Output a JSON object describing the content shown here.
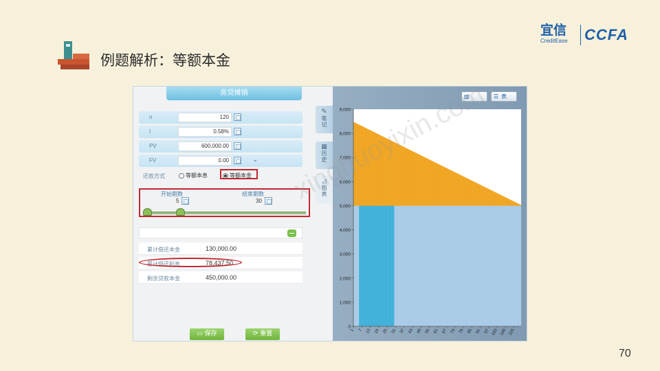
{
  "slide": {
    "title": "例题解析：等额本金",
    "page_number": "70",
    "logo_primary": "宜信",
    "logo_primary_sub": "CreditEase",
    "logo_secondary": "CCFA"
  },
  "panel": {
    "header": "房贷摊销",
    "inputs": [
      {
        "label": "n",
        "value": "120"
      },
      {
        "label": "I",
        "value": "0.58%"
      },
      {
        "label": "PV",
        "value": "600,000.00"
      },
      {
        "label": "FV",
        "value": "0.00"
      }
    ],
    "repay": {
      "label": "还款方式",
      "option_a": "等额本息",
      "option_b": "等额本金",
      "selected": "等额本金"
    },
    "period": {
      "start_label": "开始期数",
      "start_value": "5",
      "end_label": "结束期数",
      "end_value": "30"
    },
    "results": [
      {
        "label": "累计偿还本金",
        "value": "130,000.00"
      },
      {
        "label": "累计偿还利息",
        "value": "78,437.50"
      },
      {
        "label": "剩余贷款本金",
        "value": "450,000.00"
      }
    ],
    "save_label": "保存",
    "reset_label": "重置"
  },
  "side_tabs": [
    {
      "label": "笔记"
    },
    {
      "label": "历史"
    },
    {
      "label": "图表"
    }
  ],
  "chart_toolbar": {
    "chart_label": "",
    "table_label": "表"
  },
  "chart_data": {
    "type": "area",
    "x_start": 1,
    "x_end": 120,
    "x_tick_labels": [
      "1",
      "7",
      "13",
      "19",
      "25",
      "31",
      "37",
      "43",
      "49",
      "55",
      "61",
      "67",
      "73",
      "79",
      "85",
      "91",
      "97",
      "103",
      "109",
      "115"
    ],
    "y_tick_labels": [
      "0",
      "1,000",
      "2,000",
      "3,000",
      "4,000",
      "5,000",
      "6,000",
      "7,000",
      "8,000",
      "9,000"
    ],
    "ylim": [
      0,
      9000
    ],
    "series": [
      {
        "color": "#f0a21a",
        "start_value": 8480,
        "end_value": 5029
      },
      {
        "color": "#a6c9e6",
        "value": 5000
      }
    ],
    "highlight_range": [
      5,
      30
    ],
    "highlight_color": "#3aaed8"
  },
  "watermark": "xinghuoyixin.com"
}
